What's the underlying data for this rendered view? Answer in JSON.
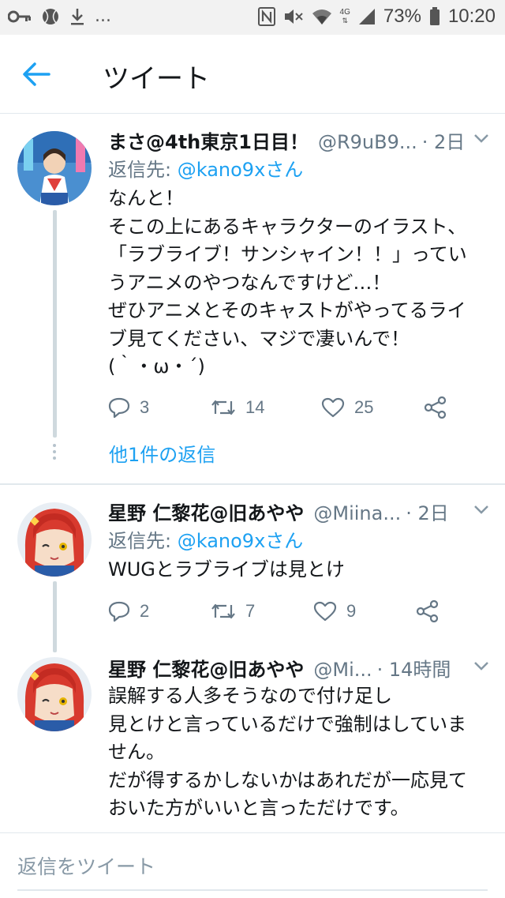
{
  "status_bar": {
    "left_icons": [
      "key-icon",
      "ball-icon",
      "download-icon"
    ],
    "ellipsis": "...",
    "battery": "73%",
    "time": "10:20",
    "network": "4G"
  },
  "header": {
    "title": "ツイート",
    "back_icon": "arrow-left-icon"
  },
  "tweets": [
    {
      "name": "まさ@4th東京1日目！",
      "handle": "@R9uB9...",
      "time": "· 2日",
      "reply_prefix": "返信先: ",
      "reply_mention": "@kano9xさん",
      "text": "なんと！\nそこの上にあるキャラクターのイラスト、\n「ラブライブ！サンシャイン！！」ってい\nうアニメのやつなんですけど…！\nぜひアニメとそのキャストがやってるライ\nブ見てください、マジで凄いんで！\n(｀・ω・´)",
      "replies": "3",
      "retweets": "14",
      "likes": "25"
    },
    {
      "name": "星野 仁黎花@旧あやや",
      "handle": "@Miina...",
      "time": "· 2日",
      "reply_prefix": "返信先: ",
      "reply_mention": "@kano9xさん",
      "text": "WUGとラブライブは見とけ",
      "replies": "2",
      "retweets": "7",
      "likes": "9"
    },
    {
      "name": "星野 仁黎花@旧あやや",
      "handle": "@Mi...",
      "time": "· 14時間",
      "text": "誤解する人多そうなので付け足し\n見とけと言っているだけで強制はしていま\nせん。\nだが得するかしないかはあれだが一応見て\nおいた方がいいと言っただけです。"
    }
  ],
  "more_replies": "他1件の返信",
  "reply_placeholder": "返信をツイート",
  "colors": {
    "accent": "#1da1f2",
    "secondary_text": "#657786",
    "divider": "#e1e8ed"
  }
}
